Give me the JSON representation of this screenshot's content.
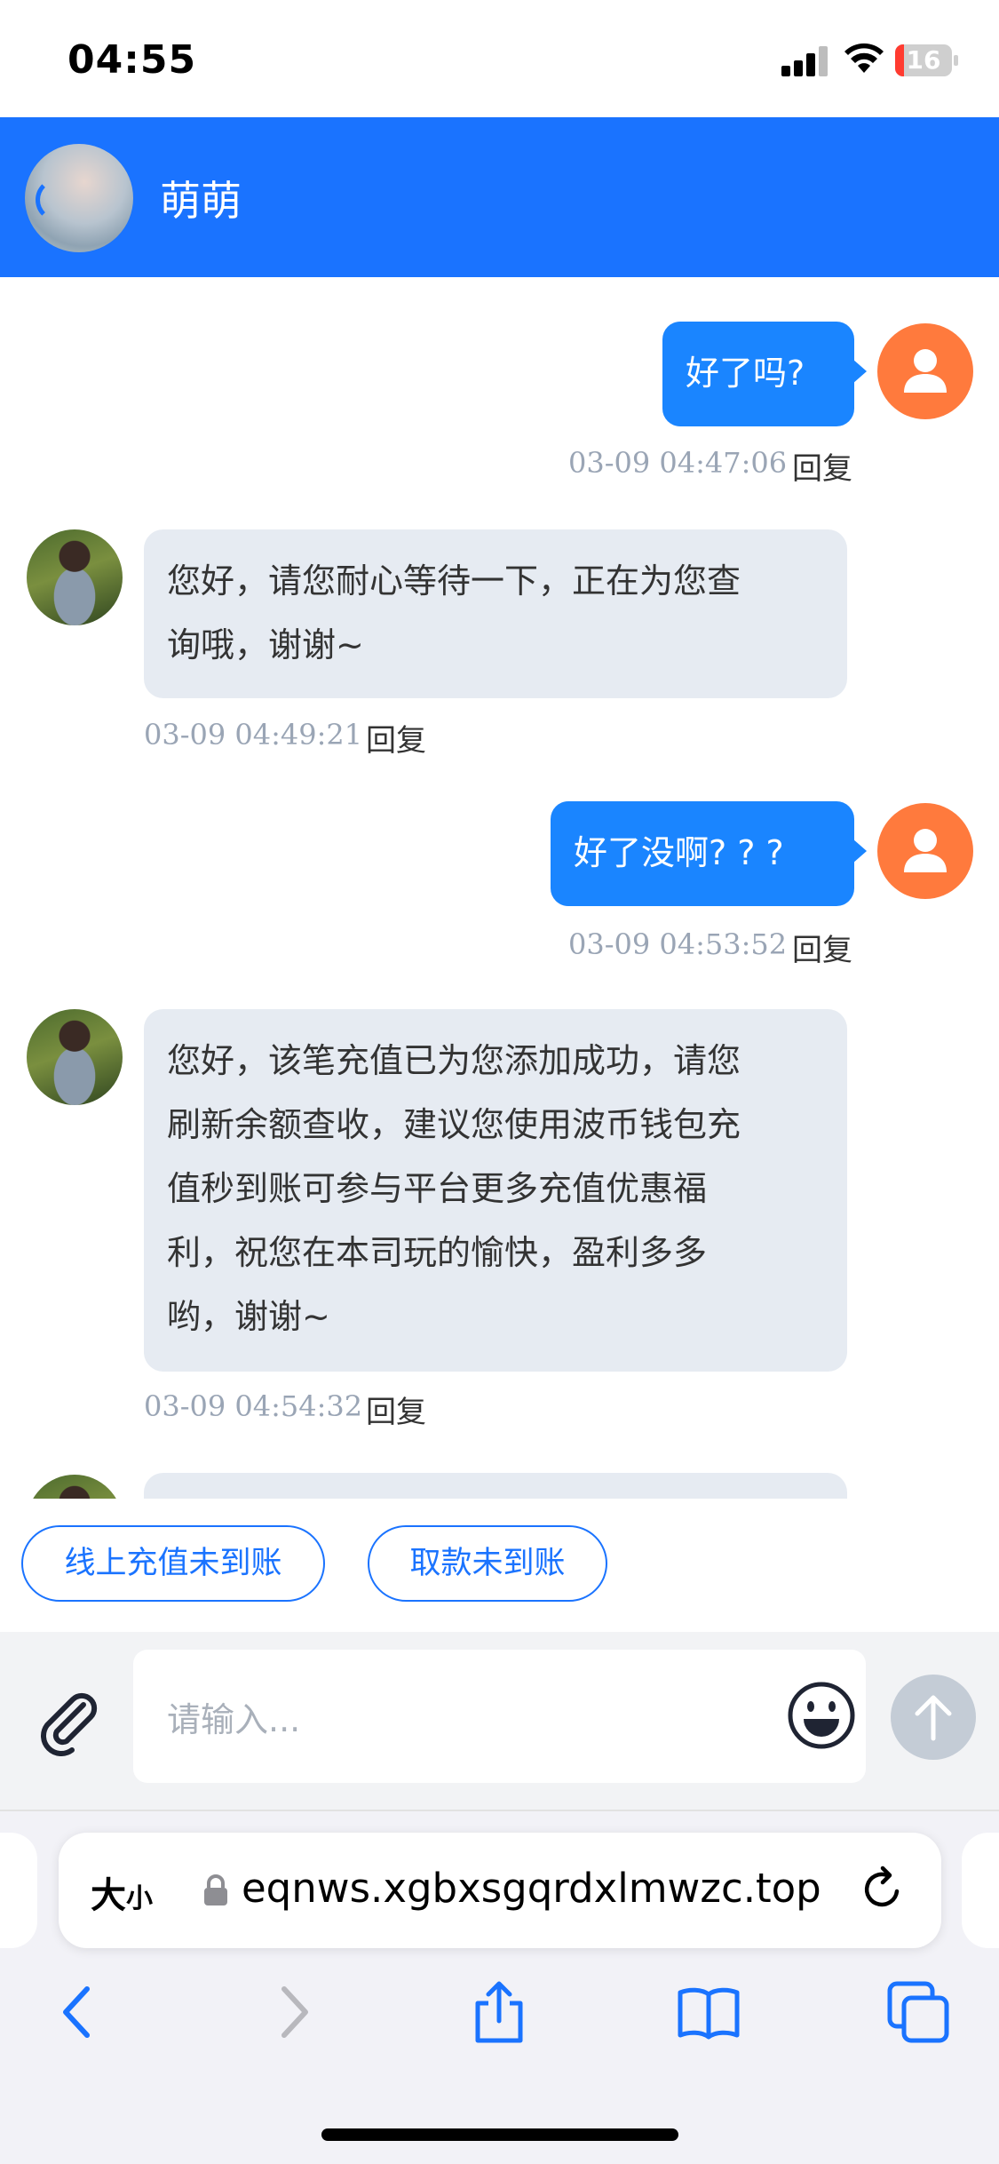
{
  "status_bar": {
    "time": "04:55",
    "battery": "16",
    "battery_level": 0.16
  },
  "header": {
    "contact_name": "萌萌"
  },
  "messages": [
    {
      "from": "user",
      "text": "好了吗?",
      "time": "03-09 04:47:06",
      "reply_label": "回复"
    },
    {
      "from": "agent",
      "lines": [
        "您好，请您耐心等待一下，正在为您查",
        "询哦，谢谢~"
      ],
      "time": "03-09 04:49:21",
      "reply_label": "回复"
    },
    {
      "from": "user",
      "text": "好了没啊? ? ?",
      "time": "03-09 04:53:52",
      "reply_label": "回复"
    },
    {
      "from": "agent",
      "lines": [
        "您好，该笔充值已为您添加成功，请您",
        "刷新余额查收，建议您使用波币钱包充",
        "值秒到账可参与平台更多充值优惠福",
        "利，祝您在本司玩的愉快，盈利多多",
        "哟，谢谢~"
      ],
      "time": "03-09 04:54:32",
      "reply_label": "回复"
    }
  ],
  "quick_replies": [
    "线上充值未到账",
    "取款未到账"
  ],
  "composer": {
    "placeholder": "请输入..."
  },
  "browser": {
    "text_size_label": "大",
    "text_size_small": "小",
    "url": "eqnws.xgbxsgqrdxlmwzc.top"
  },
  "icons": {
    "attach": "paperclip-icon",
    "emoji": "smiley-icon",
    "send": "arrow-up-icon",
    "lock": "lock-icon",
    "reload": "reload-icon",
    "back": "chevron-left-icon",
    "forward": "chevron-right-icon",
    "share": "share-icon",
    "bookmarks": "book-icon",
    "tabs": "tabs-icon"
  },
  "colors": {
    "header": "#1a73ff",
    "bubble_out": "#1a85ff",
    "bubble_in": "#e6ebf2",
    "user_avatar": "#ff7a3d"
  }
}
